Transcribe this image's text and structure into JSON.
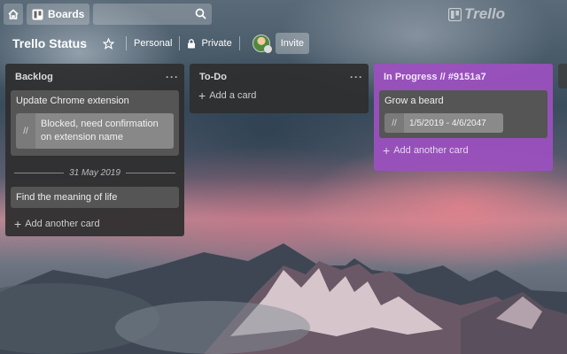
{
  "topbar": {
    "boards_label": "Boards",
    "search_value": "",
    "logo_text": "Trello"
  },
  "header": {
    "board_title": "Trello Status",
    "visibility_team": "Personal",
    "visibility_privacy": "Private",
    "invite_label": "Invite"
  },
  "lists": [
    {
      "title": "Backlog",
      "cards": [
        {
          "title": "Update Chrome extension",
          "quote_mark": "//",
          "quote": "Blocked, need confirmation on extension name"
        }
      ],
      "divider_date": "31 May 2019",
      "cards_after": [
        {
          "title": "Find the meaning of life"
        }
      ],
      "add_label": "Add another card"
    },
    {
      "title": "To-Do",
      "add_label": "Add a card"
    },
    {
      "title": "In Progress // #9151a7",
      "color": "#9151a7",
      "cards": [
        {
          "title": "Grow a beard",
          "quote_mark": "//",
          "date_range": "1/5/2019 - 4/6/2047"
        }
      ],
      "add_label": "Add another card"
    }
  ],
  "list_menu_symbol": "···",
  "add_symbol": "+",
  "icons": {
    "home": "home-icon",
    "boards": "boards-icon",
    "search": "search-icon",
    "star": "star-icon",
    "lock": "lock-icon"
  }
}
